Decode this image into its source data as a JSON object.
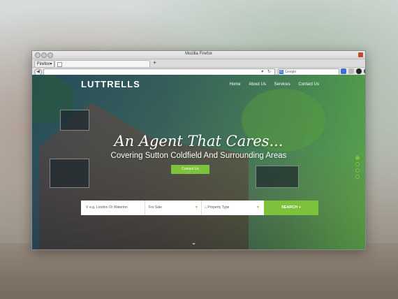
{
  "browser": {
    "title": "Mozilla Firefox",
    "menu_button": "Firefox",
    "new_tab": "+",
    "search_placeholder": "Google"
  },
  "site": {
    "logo": "LUTTRELLS",
    "nav": [
      "Home",
      "About Us",
      "Services",
      "Contact Us"
    ],
    "headline": "An Agent That Cares...",
    "subheadline": "Covering Sutton Coldfield And Surrounding Areas",
    "cta": "Contact Us",
    "search": {
      "location_placeholder": "e.g. London Or Waterton",
      "type_value": "For Sale",
      "property_value": "Property Type",
      "button": "SEARCH +"
    },
    "accent_color": "#7cc23a"
  }
}
